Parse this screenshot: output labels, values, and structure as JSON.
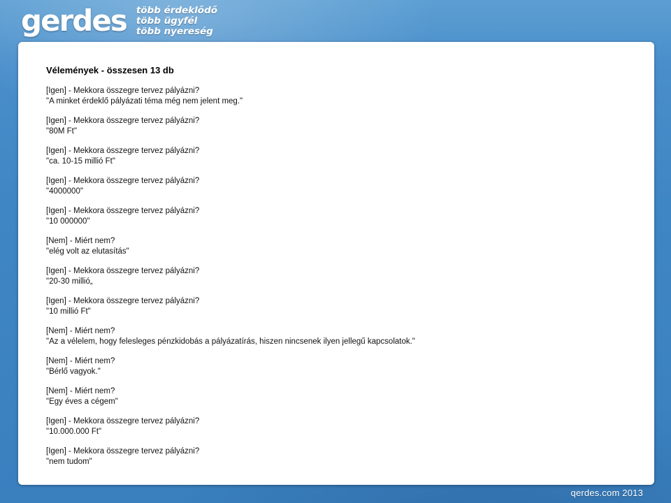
{
  "brand": {
    "logo_text": "gerdes",
    "tagline": [
      "több érdeklődő",
      "több ügyfél",
      "több nyereség"
    ]
  },
  "page": {
    "heading": "Vélemények - összesen 13 db",
    "entries": [
      {
        "question": "[Igen] - Mekkora összegre tervez pályázni?",
        "answer": "\"A minket érdeklő pályázati téma még nem jelent meg.\""
      },
      {
        "question": "[Igen] - Mekkora összegre tervez pályázni?",
        "answer": "\"80M Ft\""
      },
      {
        "question": "[Igen] - Mekkora összegre tervez pályázni?",
        "answer": "\"ca. 10-15 millió Ft\""
      },
      {
        "question": "[Igen] - Mekkora összegre tervez pályázni?",
        "answer": "\"4000000\""
      },
      {
        "question": "[Igen] - Mekkora összegre tervez pályázni?",
        "answer": "\"10 000000\""
      },
      {
        "question": "[Nem] - Miért nem?",
        "answer": "\"elég volt az elutasítás\""
      },
      {
        "question": "[Igen] - Mekkora összegre tervez pályázni?",
        "answer": "\"20-30 millió„"
      },
      {
        "question": "[Igen] - Mekkora összegre tervez pályázni?",
        "answer": "\"10 millió Ft\""
      },
      {
        "question": "[Nem] - Miért nem?",
        "answer": "\"Az a vélelem, hogy felesleges pénzkidobás a pályázatírás, hiszen nincsenek ilyen jellegű kapcsolatok.\""
      },
      {
        "question": "[Nem] - Miért nem?",
        "answer": "\"Bérlő vagyok.\""
      },
      {
        "question": "[Nem] - Miért nem?",
        "answer": "\"Egy éves a cégem\""
      },
      {
        "question": "[Igen] - Mekkora összegre tervez pályázni?",
        "answer": "\"10.000.000 Ft\""
      },
      {
        "question": "[Igen] - Mekkora összegre tervez pályázni?",
        "answer": "\"nem tudom\""
      }
    ]
  },
  "footer": {
    "text": "qerdes.com 2013"
  }
}
